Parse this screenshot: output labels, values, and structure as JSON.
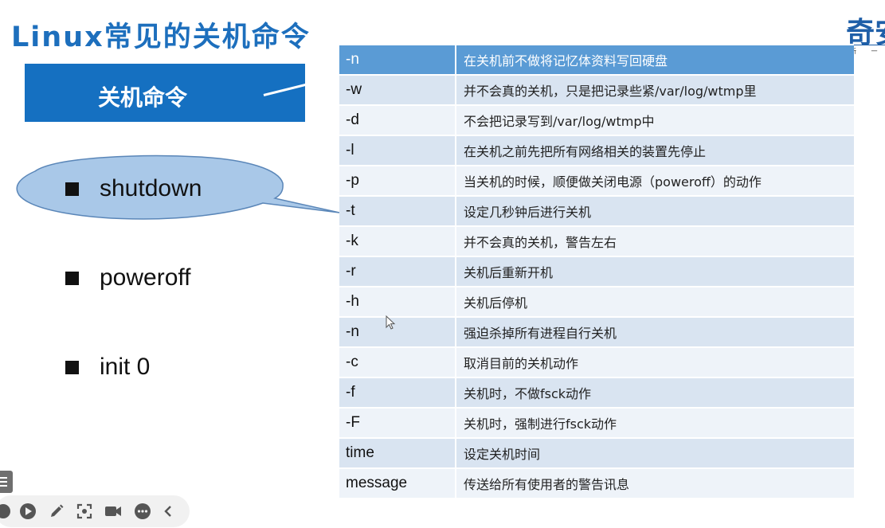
{
  "slide": {
    "title": "Linux常见的关机命令",
    "logo_text": "奇",
    "logo_text2": "安",
    "logo_sub": "新 一 代",
    "header_label": "关机命令"
  },
  "commands": [
    {
      "label": "shutdown"
    },
    {
      "label": "poweroff"
    },
    {
      "label": "init 0"
    }
  ],
  "options_table": {
    "rows": [
      {
        "flag": "-n",
        "desc": "在关机前不做将记忆体资料写回硬盘"
      },
      {
        "flag": "-w",
        "desc": "并不会真的关机，只是把记录些紧/var/log/wtmp里"
      },
      {
        "flag": "-d",
        "desc": "不会把记录写到/var/log/wtmp中"
      },
      {
        "flag": "-l",
        "desc": "在关机之前先把所有网络相关的装置先停止"
      },
      {
        "flag": "-p",
        "desc": "当关机的时候，顺便做关闭电源（poweroff）的动作"
      },
      {
        "flag": "-t",
        "desc": "设定几秒钟后进行关机"
      },
      {
        "flag": "-k",
        "desc": "并不会真的关机，警告左右"
      },
      {
        "flag": "-r",
        "desc": "关机后重新开机"
      },
      {
        "flag": "-h",
        "desc": "关机后停机"
      },
      {
        "flag": "-n",
        "desc": "强迫杀掉所有进程自行关机"
      },
      {
        "flag": "-c",
        "desc": "取消目前的关机动作"
      },
      {
        "flag": "-f",
        "desc": "关机时，不做fsck动作"
      },
      {
        "flag": "-F",
        "desc": "关机时，强制进行fsck动作"
      },
      {
        "flag": "time",
        "desc": "设定关机时间"
      },
      {
        "flag": "message",
        "desc": "传送给所有使用者的警告讯息"
      }
    ]
  },
  "toolbar": {
    "icons": [
      "circle-icon",
      "play-icon",
      "pen-icon",
      "screenshot-icon",
      "camera-icon",
      "more-icon",
      "chevron-left-icon"
    ]
  },
  "colors": {
    "accent": "#1570c1",
    "header_row": "#5a9bd5",
    "row_odd": "#d9e4f1",
    "row_even": "#eef3f9",
    "callout_fill": "#a9c8e8"
  }
}
